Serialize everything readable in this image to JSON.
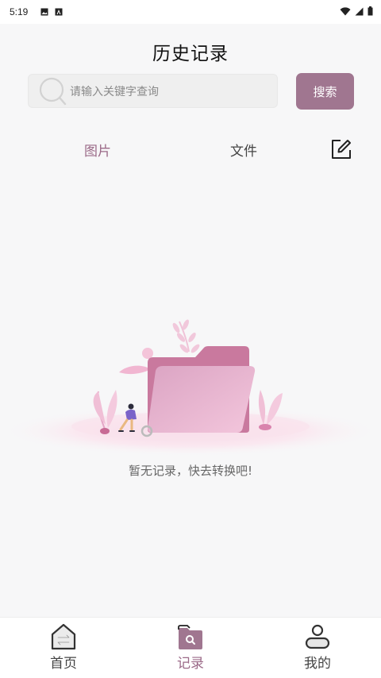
{
  "status_bar": {
    "time": "5:19"
  },
  "header": {
    "title": "历史记录"
  },
  "search": {
    "placeholder": "请输入关键字查询",
    "value": "",
    "button_label": "搜索"
  },
  "tabs": [
    {
      "label": "图片",
      "active": true
    },
    {
      "label": "文件",
      "active": false
    }
  ],
  "empty_state": {
    "message": "暂无记录，快去转换吧!"
  },
  "bottom_nav": [
    {
      "label": "首页",
      "icon": "home-swap-icon",
      "active": false
    },
    {
      "label": "记录",
      "icon": "folder-search-icon",
      "active": true
    },
    {
      "label": "我的",
      "icon": "user-icon",
      "active": false
    }
  ],
  "colors": {
    "accent": "#a07690",
    "accent_text": "#9b6a88",
    "background": "#f7f7f8"
  }
}
